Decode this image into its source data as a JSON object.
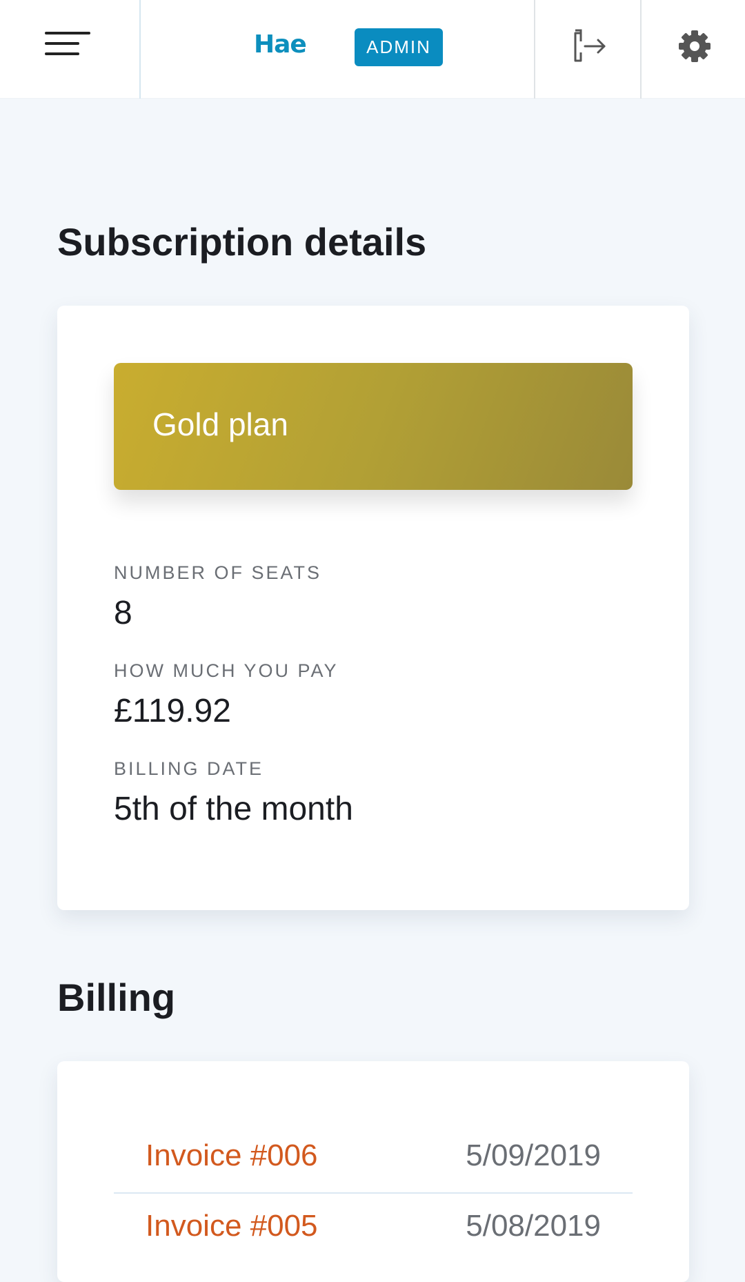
{
  "header": {
    "logo_text": "Hae",
    "role_badge": "ADMIN",
    "icons": {
      "menu": "hamburger-menu-icon",
      "logout": "logout-icon",
      "settings": "gear-icon"
    }
  },
  "subscription": {
    "title": "Subscription details",
    "plan_name": "Gold plan",
    "fields": [
      {
        "label": "NUMBER OF SEATS",
        "value": "8"
      },
      {
        "label": "HOW MUCH YOU PAY",
        "value": "£119.92"
      },
      {
        "label": "BILLING DATE",
        "value": "5th of the month"
      }
    ]
  },
  "billing": {
    "title": "Billing",
    "invoices": [
      {
        "label": "Invoice #006",
        "date": "5/09/2019"
      },
      {
        "label": "Invoice #005",
        "date": "5/08/2019"
      }
    ]
  },
  "colors": {
    "accent": "#0a8cc0",
    "invoice_link": "#d2591e",
    "plan_gold_start": "#c9ad2f",
    "plan_gold_end": "#9a8a38",
    "page_background": "#f3f7fb"
  }
}
